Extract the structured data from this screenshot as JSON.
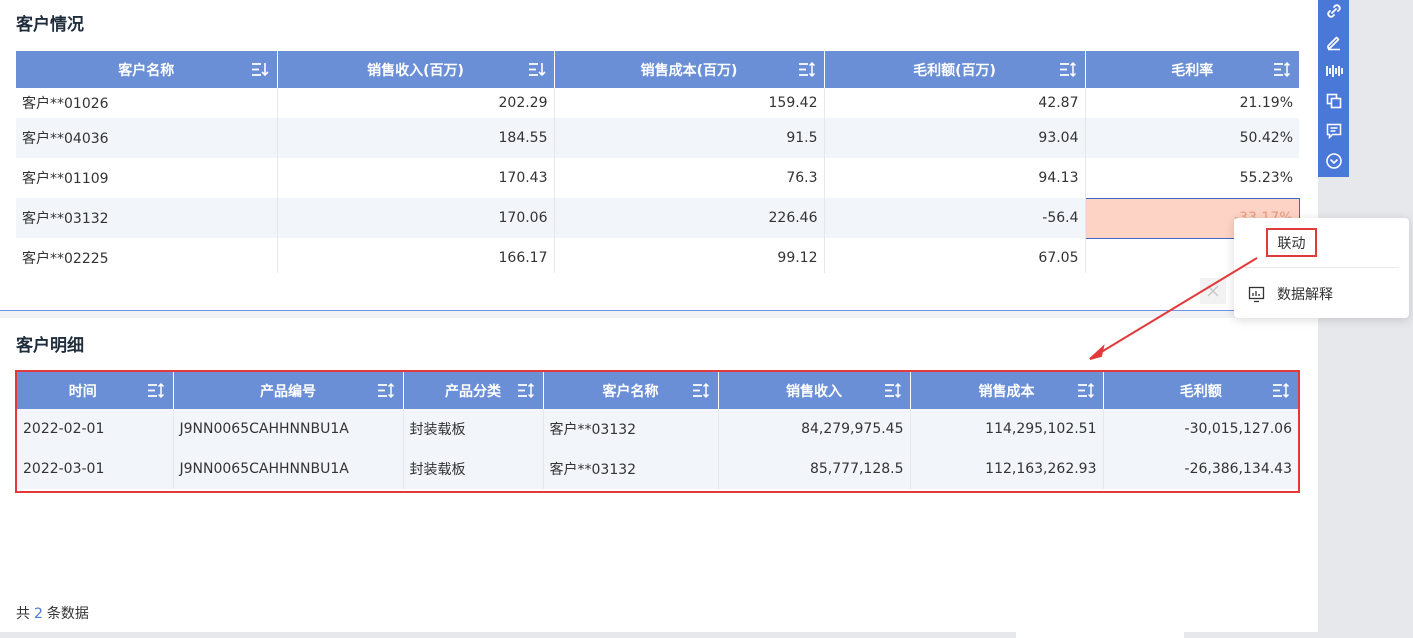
{
  "summary": {
    "title": "客户情况",
    "columns": [
      "客户名称",
      "销售收入(百万)",
      "销售成本(百万)",
      "毛利额(百万)",
      "毛利率"
    ],
    "rows": [
      [
        "客户**01026",
        "202.29",
        "159.42",
        "42.87",
        "21.19%"
      ],
      [
        "客户**04036",
        "184.55",
        "91.5",
        "93.04",
        "50.42%"
      ],
      [
        "客户**01109",
        "170.43",
        "76.3",
        "94.13",
        "55.23%"
      ],
      [
        "客户**03132",
        "170.06",
        "226.46",
        "-56.4",
        "-33.17%"
      ],
      [
        "客户**02225",
        "166.17",
        "99.12",
        "67.05",
        ""
      ]
    ]
  },
  "detail": {
    "title": "客户明细",
    "columns": [
      "时间",
      "产品编号",
      "产品分类",
      "客户名称",
      "销售收入",
      "销售成本",
      "毛利额"
    ],
    "rows": [
      [
        "2022-02-01",
        "J9NN0065CAHHNNBU1A",
        "封装载板",
        "客户**03132",
        "84,279,975.45",
        "114,295,102.51",
        "-30,015,127.06"
      ],
      [
        "2022-03-01",
        "J9NN0065CAHHNNBU1A",
        "封装载板",
        "客户**03132",
        "85,777,128.5",
        "112,163,262.93",
        "-26,386,134.43"
      ]
    ],
    "footer": {
      "prefix": "共",
      "count": "2",
      "suffix": "条数据"
    }
  },
  "context_menu": {
    "link_label": "联动",
    "explain_label": "数据解释"
  },
  "toolbar_icons": [
    "link-icon",
    "edit-icon",
    "bar-chart-icon",
    "copy-icon",
    "comment-icon",
    "chevron-circle-icon"
  ],
  "colors": {
    "header": "#6a8fd6",
    "accent": "#4a78d8",
    "highlight": "#fcd3c4",
    "annotation": "#e23a3a"
  }
}
